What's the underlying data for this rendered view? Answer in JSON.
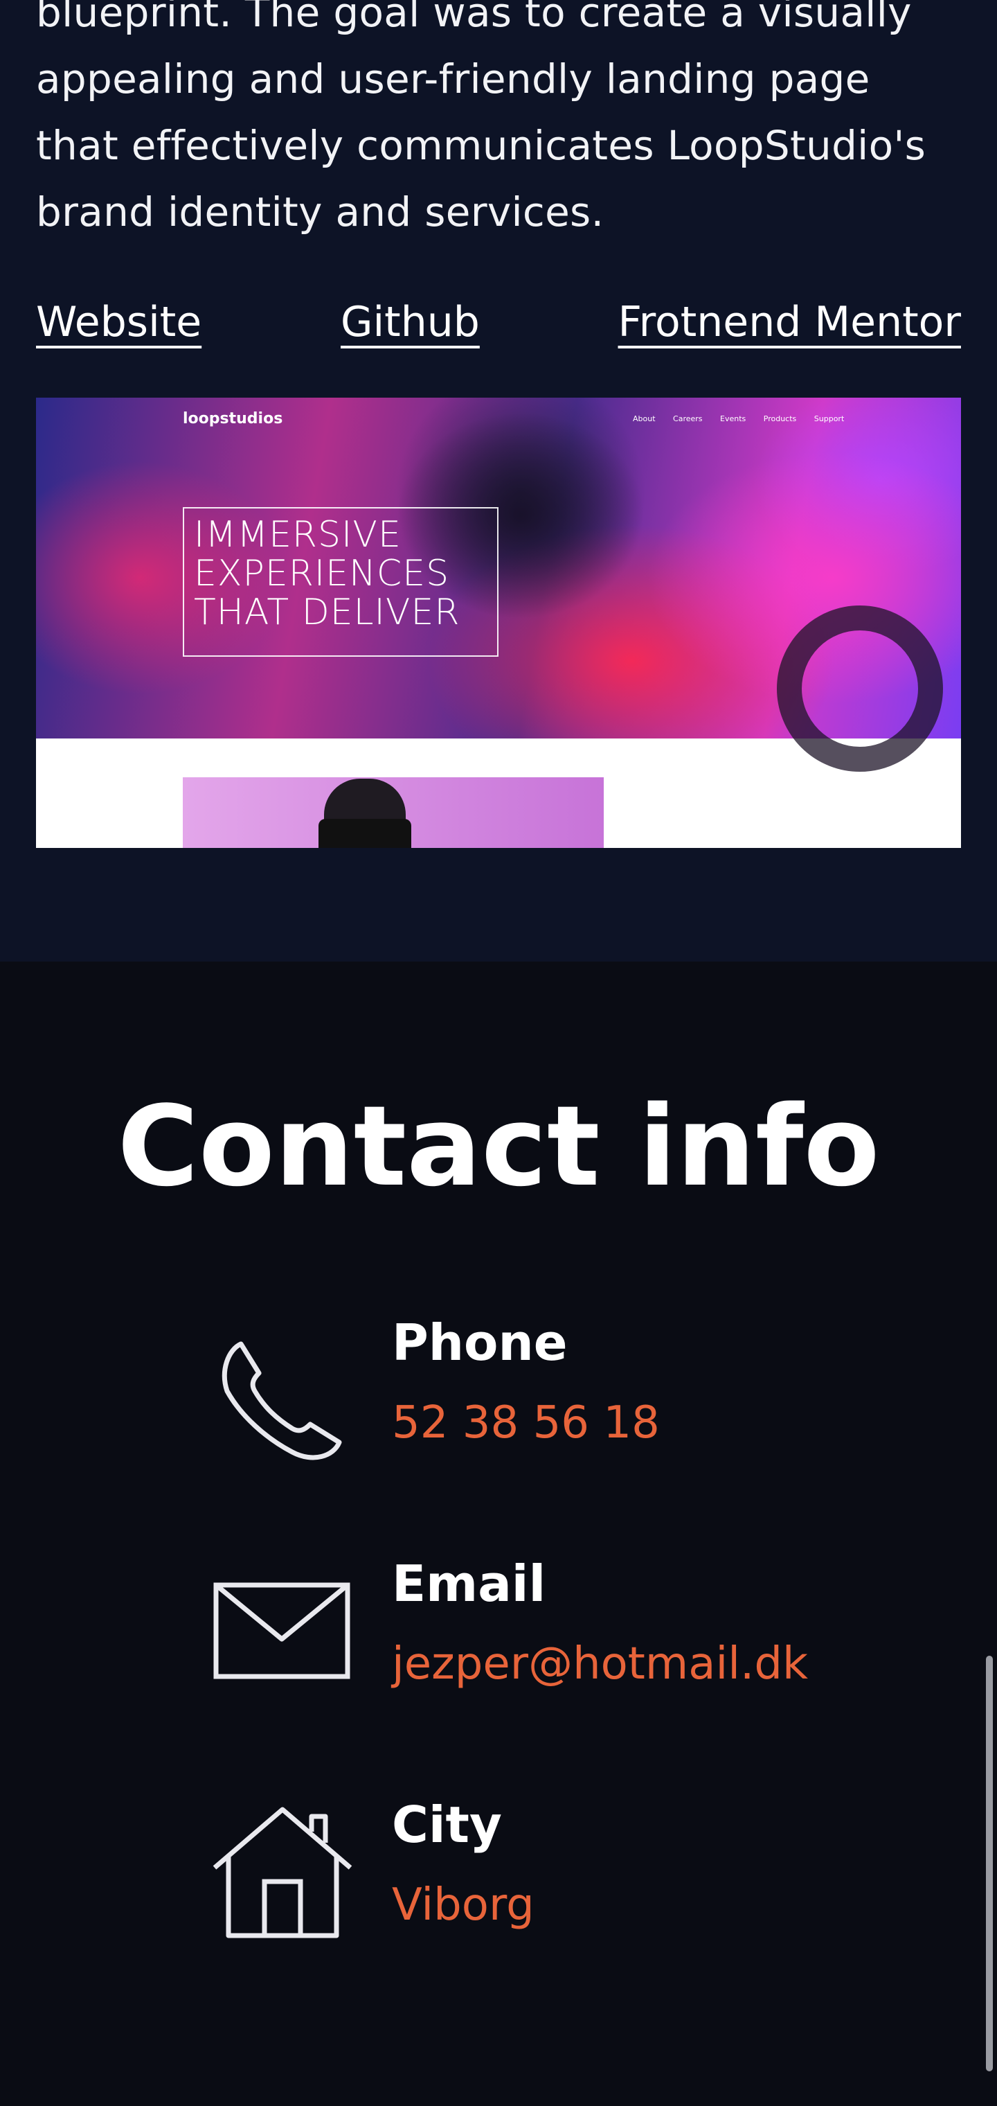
{
  "project": {
    "description": "blueprint. The goal was to create a visually appealing and user-friendly landing page that effectively communicates LoopStudio's brand identity and services.",
    "links": {
      "website": "Website",
      "github": "Github",
      "frontend_mentor": "Frotnend Mentor"
    },
    "preview": {
      "logo": "loopstudios",
      "nav": [
        "About",
        "Careers",
        "Events",
        "Products",
        "Support"
      ],
      "headline": "IMMERSIVE\nEXPERIENCES\nTHAT DELIVER"
    }
  },
  "contact": {
    "title": "Contact info",
    "items": [
      {
        "label": "Phone",
        "value": "52 38 56 18",
        "icon": "phone-icon"
      },
      {
        "label": "Email",
        "value": "jezper@hotmail.dk",
        "icon": "envelope-icon"
      },
      {
        "label": "City",
        "value": "Viborg",
        "icon": "house-icon"
      }
    ],
    "accent_color": "#e8643a"
  },
  "colors": {
    "project_bg": "#0d1326",
    "contact_bg": "#0a0c14"
  }
}
